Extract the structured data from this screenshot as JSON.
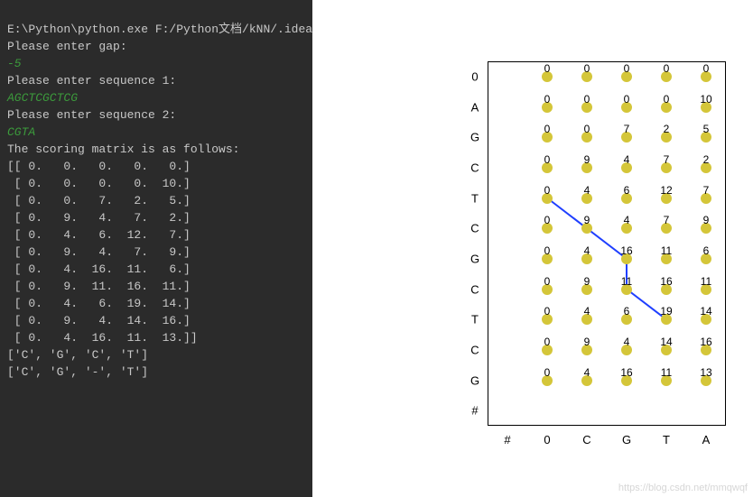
{
  "terminal": {
    "cmd": "E:\\Python\\python.exe F:/Python文档/kNN/.idea",
    "prompt_gap": "Please enter gap:",
    "input_gap": "-5",
    "prompt_seq1": "Please enter sequence 1:",
    "input_seq1": "AGCTCGCTCG",
    "prompt_seq2": "Please enter sequence 2:",
    "input_seq2": "CGTA",
    "matrix_header": "The scoring matrix is as follows:",
    "matrix": [
      "[[ 0.   0.   0.   0.   0.]",
      " [ 0.   0.   0.   0.  10.]",
      " [ 0.   0.   7.   2.   5.]",
      " [ 0.   9.   4.   7.   2.]",
      " [ 0.   4.   6.  12.   7.]",
      " [ 0.   9.   4.   7.   9.]",
      " [ 0.   4.  16.  11.   6.]",
      " [ 0.   9.  11.  16.  11.]",
      " [ 0.   4.   6.  19.  14.]",
      " [ 0.   9.   4.  14.  16.]",
      " [ 0.   4.  16.  11.  13.]]"
    ],
    "align1": "['C', 'G', 'C', 'T']",
    "align2": "['C', 'G', '-', 'T']"
  },
  "chart_data": {
    "type": "heatmap",
    "title": "",
    "x_axis": [
      "#",
      "0",
      "C",
      "G",
      "T",
      "A"
    ],
    "y_axis": [
      "0",
      "A",
      "G",
      "C",
      "T",
      "C",
      "G",
      "C",
      "T",
      "C",
      "G",
      "#"
    ],
    "grid": [
      [
        0,
        0,
        0,
        0,
        0
      ],
      [
        0,
        0,
        0,
        0,
        10
      ],
      [
        0,
        0,
        7,
        2,
        5
      ],
      [
        0,
        9,
        4,
        7,
        2
      ],
      [
        0,
        4,
        6,
        12,
        7
      ],
      [
        0,
        9,
        4,
        7,
        9
      ],
      [
        0,
        4,
        16,
        11,
        6
      ],
      [
        0,
        9,
        11,
        16,
        11
      ],
      [
        0,
        4,
        6,
        19,
        14
      ],
      [
        0,
        9,
        4,
        14,
        16
      ],
      [
        0,
        4,
        16,
        11,
        13
      ]
    ],
    "path": [
      {
        "row": 4,
        "col": 0
      },
      {
        "row": 5,
        "col": 1
      },
      {
        "row": 6,
        "col": 2
      },
      {
        "row": 7,
        "col": 2
      },
      {
        "row": 8,
        "col": 3
      }
    ],
    "xlabel": "",
    "ylabel": ""
  },
  "watermark": "https://blog.csdn.net/mmqwqf"
}
